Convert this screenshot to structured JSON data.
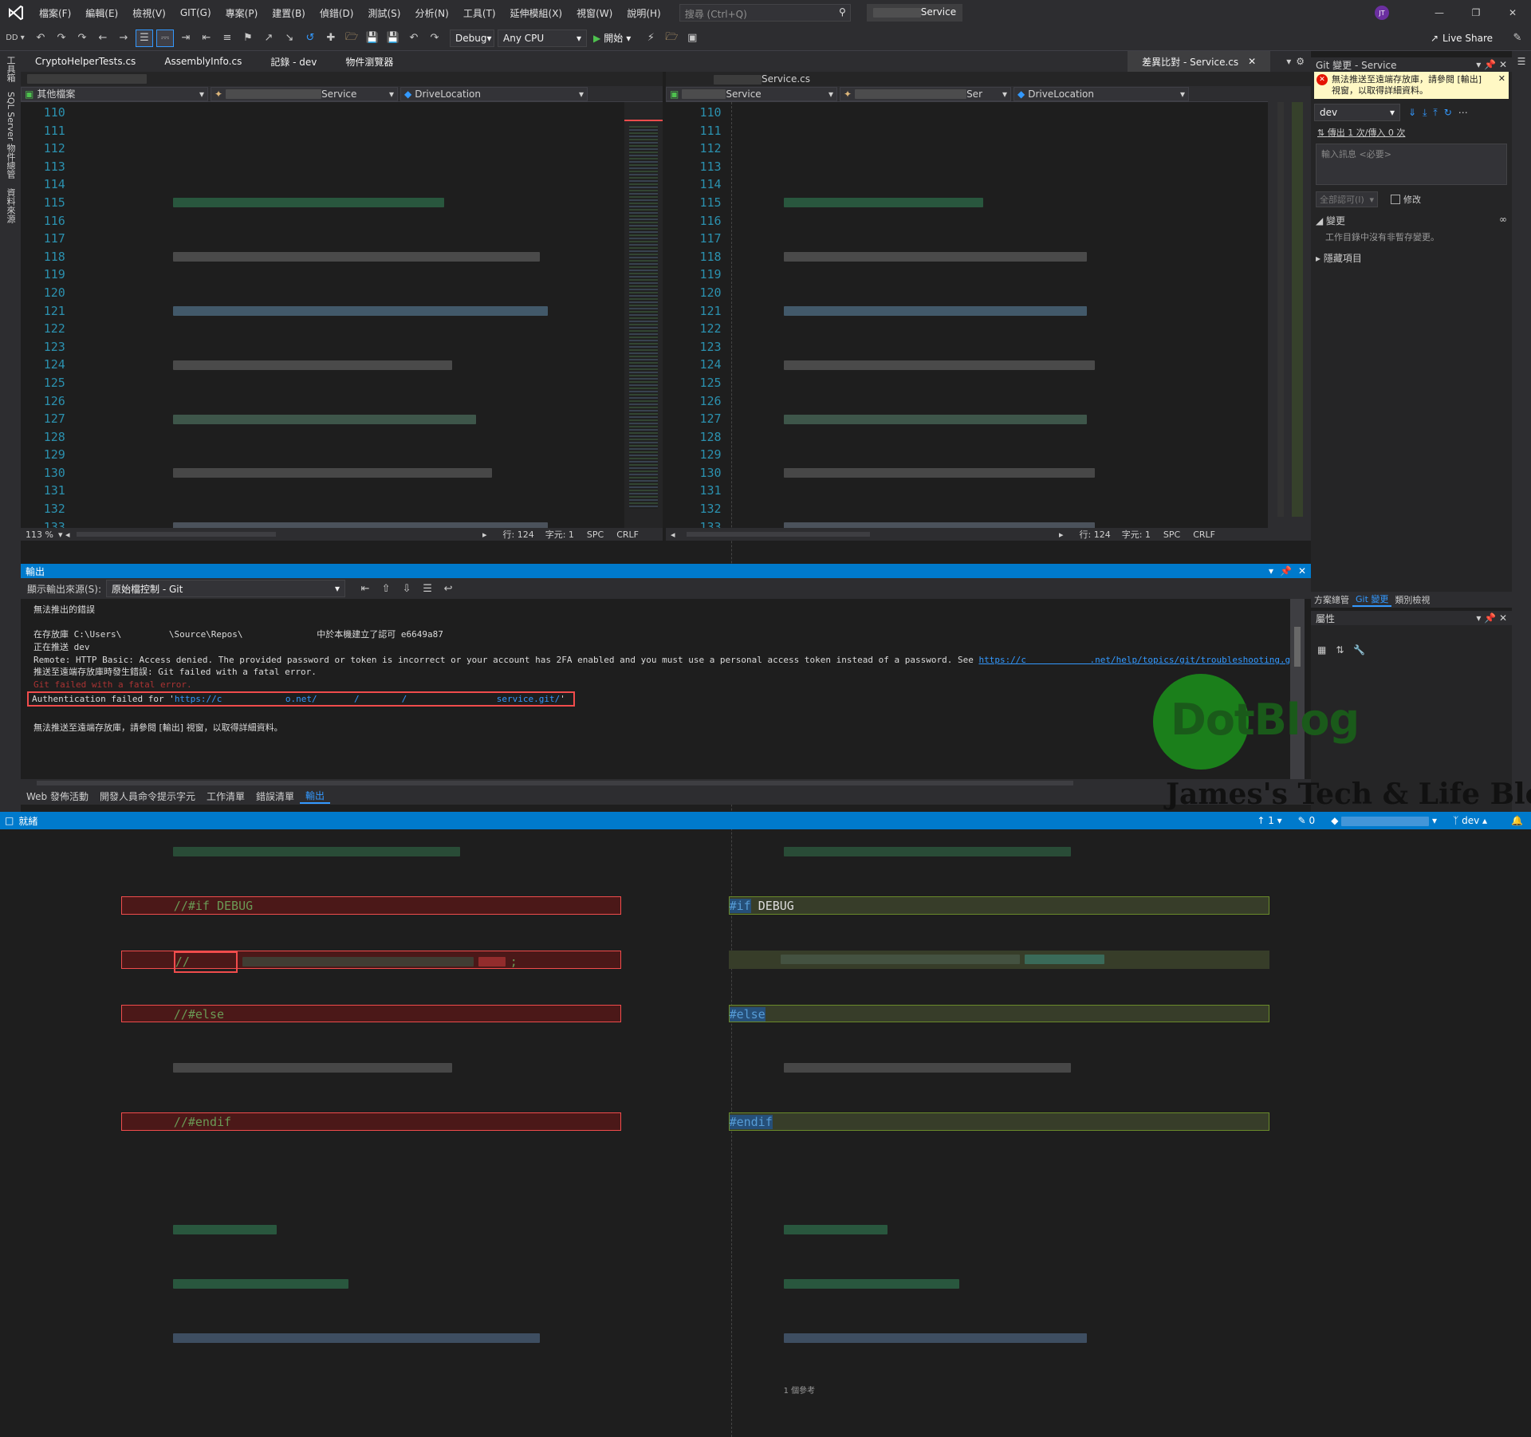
{
  "titlebar": {
    "menus": [
      "檔案(F)",
      "編輯(E)",
      "檢視(V)",
      "GIT(G)",
      "專案(P)",
      "建置(B)",
      "偵錯(D)",
      "測試(S)",
      "分析(N)",
      "工具(T)",
      "延伸模組(X)",
      "視窗(W)",
      "說明(H)"
    ],
    "search_placeholder": "搜尋 (Ctrl+Q)",
    "solution_name": "Service",
    "avatar": "JT",
    "live_share": "Live Share"
  },
  "toolbar": {
    "config": "Debug",
    "platform": "Any CPU",
    "start": "開始"
  },
  "side_tabs": {
    "left": [
      "工具箱",
      "SQL Server 物件總管",
      "資料來源"
    ]
  },
  "doc_tabs": {
    "left_tabs": [
      "CryptoHelperTests.cs",
      "AssemblyInfo.cs",
      "記錄 - dev",
      "物件瀏覽器"
    ],
    "compare_tab": "差異比對 - Service.cs",
    "right_file": "Service.cs"
  },
  "left_pane": {
    "nav_project": "其他檔案",
    "nav_class": "Service",
    "nav_member": "DriveLocation",
    "lines": [
      "110",
      "111",
      "112",
      "113",
      "114",
      "115",
      "116",
      "117",
      "118",
      "119",
      "120",
      "121",
      "122",
      "123",
      "124",
      "125",
      "126",
      "127",
      "128",
      "129",
      "130",
      "131",
      "132",
      "133"
    ],
    "code_124": "//#if DEBUG",
    "code_125": "//",
    "code_125_end": ";",
    "code_126": "//#else",
    "code_128": "//#endif",
    "zoom": "113 %",
    "row": "行: 124",
    "col": "字元: 1",
    "spc": "SPC",
    "crlf": "CRLF"
  },
  "right_pane": {
    "nav_project": "Service",
    "nav_class": "Ser",
    "nav_member": "DriveLocation",
    "lines": [
      "110",
      "111",
      "112",
      "113",
      "114",
      "115",
      "116",
      "117",
      "118",
      "119",
      "120",
      "121",
      "122",
      "123",
      "124",
      "125",
      "126",
      "127",
      "128",
      "129",
      "130",
      "131",
      "132",
      "133"
    ],
    "code_124_kw": "#if",
    "code_124_sym": "DEBUG",
    "code_126": "#else",
    "code_128": "#endif",
    "codelens": "1 個參考",
    "row": "行: 124",
    "col": "字元: 1",
    "spc": "SPC",
    "crlf": "CRLF"
  },
  "output": {
    "title": "輸出",
    "source_label": "顯示輸出來源(S):",
    "source_value": "原始檔控制 - Git",
    "lines": [
      "無法推出的錯誤",
      "",
      "在存放庫 C:\\Users\\         \\Source\\Repos\\              中於本機建立了認可 e6649a87",
      "正在推送 dev",
      "Remote: HTTP Basic: Access denied. The provided password or token is incorrect or your account has 2FA enabled and you must use a personal access token instead of a password. See ",
      "推送至遠端存放庫時發生錯誤: Git failed with a fatal error.",
      "Git failed with a fatal error.",
      "Authentication failed for '",
      "",
      "無法推送至遠端存放庫，請參閱 [輸出] 視窗，以取得詳細資料。"
    ],
    "link_1": "https://c            .net/help/topics/git/troubleshooting.git#error-on-git-fetch-h",
    "auth_url": "https://c            o.net/       /        /                 service.git/",
    "auth_tail": "'"
  },
  "bottom_tabs": [
    "Web 發佈活動",
    "開發人員命令提示字元",
    "工作清單",
    "錯誤清單",
    "輸出"
  ],
  "git_panel": {
    "title": "Git 變更 - Service",
    "error": "無法推送至遠端存放庫，請參閱 [輸出] 視窗，以取得詳細資料。",
    "branch": "dev",
    "sync": "傳出 1 次/傳入 0 次",
    "message_placeholder": "輸入訊息 <必要>",
    "commit_all": "全部認可(I)",
    "amend": "修改",
    "changes": "變更",
    "changes_note": "工作目錄中沒有非暫存變更。",
    "hidden": "隱藏項目"
  },
  "right_tabs": [
    "方案總管",
    "Git 變更",
    "類別檢視"
  ],
  "properties": {
    "title": "屬性"
  },
  "watermark": {
    "logo_text": "DotBlog",
    "blog": "James's Tech & Life Blog"
  },
  "statusbar": {
    "ready": "就緒",
    "up": "1",
    "pencil": "0",
    "branch": "dev"
  }
}
